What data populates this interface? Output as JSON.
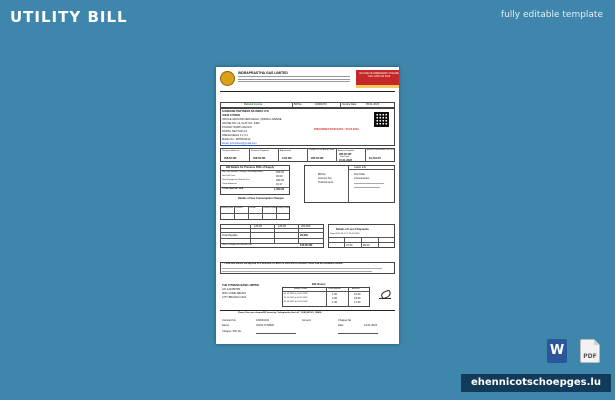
{
  "page": {
    "title": "UTILITY BILL",
    "subtitle": "fully editable template",
    "site": "ehennicotschoepges.lu",
    "word_icon_letter": "W",
    "pdf_icon_label": "PDF"
  },
  "bill": {
    "company": "INDRAPRASTHA GAS LIMITED",
    "redbox_text": "IN CASE OF EMERGENCY PLEASE CALL 1800 102 5109",
    "bill_type": "Refund Invoice",
    "bill_no_label": "Bill No.",
    "bill_no": "10004470",
    "invoice_date_label": "Invoice Date",
    "invoice_date": "05.01.2023",
    "customer_name": "SUNSHINE PARTNERS NS INFRA LTD",
    "customer_line2": "JOHN CITIZEN",
    "address_lines": [
      "OFFICE GROUND NEW DELHI, (IN)FRA LICENSE",
      "HOUSE NO. 12, FLAT NO. 3400",
      "POCKET NORTH BLOCK",
      "NORTH SECTOR 4 A",
      "FRESH DELHI 1 2 3 1"
    ],
    "mobile": "Mobile No.: 9876543210",
    "email": "Email: johncitizen@gmail.com",
    "disconnection": "DISCONNECTION DATE : 25.04.2023",
    "summary_headers": [
      "Previous Balance",
      "Previous Payment",
      "Adjustment",
      "Charges for this Billing Period",
      "Amount Payable",
      "Amount Payable After Due Date"
    ],
    "summary_values": [
      "358.50 DR",
      "358.50 DR",
      "0.00 DR",
      "285.00 DR",
      "283.00 DR",
      "$1,434.00"
    ],
    "due_date_label": "Due Date",
    "due_date": "15.01.2023",
    "bill_details_title": "Bill Details for Previous PNG of Supply",
    "detail_rows": [
      {
        "label": "Non Gas Network Charges: Fine Adjustment",
        "value": "200.45"
      },
      {
        "label": "Gas Unit Cost",
        "value": "90.00"
      },
      {
        "label": "Total Charges for Natural Gas",
        "value": "290.45"
      },
      {
        "label": "Current Amount",
        "value": "10.17"
      },
      {
        "label": "TOTAL AMOUNT DUE",
        "value": "1,300.00"
      }
    ],
    "consumption_title": "Details of Gas Consumption Charges",
    "right_labels": [
      "Latest Info",
      "Bill No.",
      "Account No.",
      "Total Amount",
      "Due Date",
      "Consumption"
    ],
    "reading_headers": [
      "Reading Date",
      "Previous",
      "Current",
      "Previous Reading",
      "Closing Reading"
    ],
    "meter_values": [
      "125.00",
      "125.00",
      "250.000"
    ],
    "payable_label": "Total Payable",
    "payable_value": "28,900",
    "net_payable_label": "Gross Charges for Natural Gas",
    "net_payable": "100.00 DR",
    "pay_title": "Details of Last 3 Payments",
    "pay_row": "Page 2001-20 1 2 3 12.01.2023",
    "pay_values": [
      "47.00",
      "89.00"
    ],
    "notice": "** Credit note that are not adjusted for a minimum of 6 BILLs or more will be refunded. Please read the conditions overleaf.",
    "bank_title": "THE CITIZENS BANK LIMITED",
    "bank_lines": [
      "A/C 123456789",
      "IFSC CODE AB0123",
      "CITY BRANCH 1234"
    ],
    "bill_history_title": "Bill History",
    "history_headers": [
      "Billing Period",
      "Consumption",
      "Amount"
    ],
    "history_rows": [
      [
        "01.12.2022 to 31.12.2022",
        "1.00",
        "12.30"
      ],
      [
        "01.11.2022 to 30.11.2022",
        "2.00",
        "24.50"
      ],
      [
        "01.10.2022 to 31.10.2022",
        "1.40",
        "17.40"
      ]
    ],
    "slip_title": "Please Give your cheque/DD favouring \"Indraprastha Gas Ltd\". CHEQUE NO. 123456",
    "slip_labels": [
      "Contract No",
      "Amount",
      "Cheque No",
      "Name",
      "Date",
      "Cheque / DD No."
    ],
    "slip_values": [
      "100001234",
      "JOHN CITIZEN",
      "12.01.2023"
    ]
  }
}
